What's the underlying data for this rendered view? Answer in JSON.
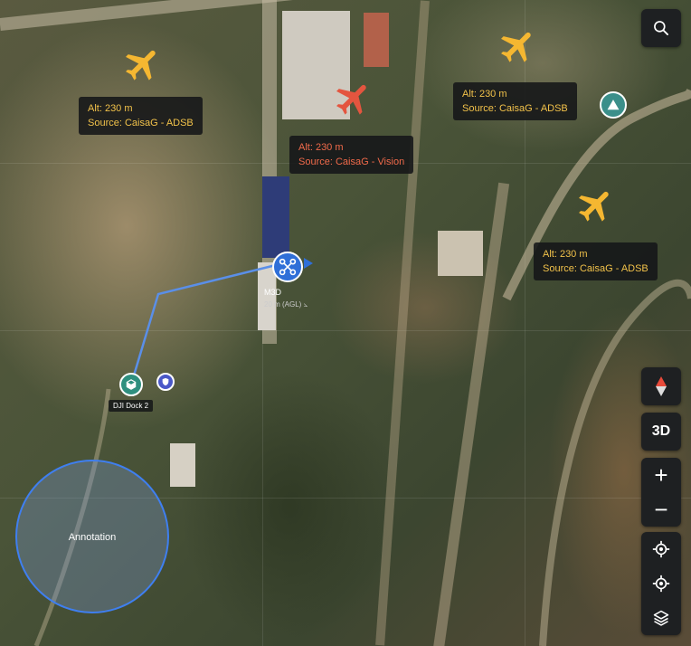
{
  "map": {
    "aircraft": [
      {
        "id": "adsb-1",
        "source_type": "adsb",
        "color": "#f5b731"
      },
      {
        "id": "vision-1",
        "source_type": "vision",
        "color": "#e4553f"
      },
      {
        "id": "adsb-2",
        "source_type": "adsb",
        "color": "#f5b731"
      },
      {
        "id": "adsb-3",
        "source_type": "adsb",
        "color": "#f5b731"
      }
    ],
    "callouts": [
      {
        "alt": "Alt: 230 m",
        "source": "Source: CaisaG - ADSB"
      },
      {
        "alt": "Alt: 230 m",
        "source": "Source: CaisaG - Vision"
      },
      {
        "alt": "Alt: 230 m",
        "source": "Source: CaisaG - ADSB"
      },
      {
        "alt": "Alt: 230 m",
        "source": "Source: CaisaG - ADSB"
      }
    ],
    "drone": {
      "name": "M3D",
      "altitude": "20 m (AGL)",
      "color": "#2f6fd8"
    },
    "dock": {
      "name": "DJI Dock 2",
      "color": "#2f8f7f"
    },
    "annotation": {
      "label": "Annotation",
      "color": "#3f7ff0"
    },
    "warning_icon": "warning-triangle-icon"
  },
  "controls": {
    "search_icon": "search-icon",
    "compass_icon": "compass-icon",
    "view_3d": "3D",
    "zoom_in": "+",
    "zoom_out": "−",
    "locate_icon": "crosshair-icon",
    "locate_drone_icon": "crosshair-icon",
    "layers_icon": "layers-icon"
  }
}
